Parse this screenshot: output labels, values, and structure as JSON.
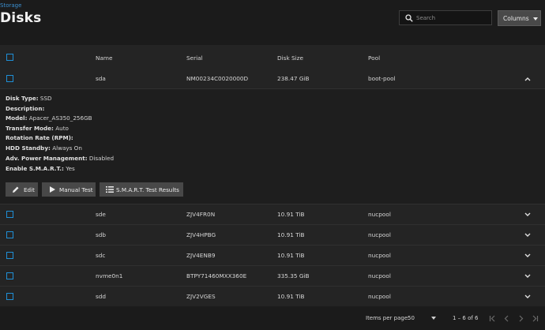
{
  "breadcrumb": "Storage",
  "page_title": "Disks",
  "search": {
    "placeholder": "Search"
  },
  "columns_button": {
    "label": "Columns"
  },
  "table": {
    "headers": [
      "Name",
      "Serial",
      "Disk Size",
      "Pool"
    ],
    "rows": [
      {
        "name": "sda",
        "serial": "NM00234C0020000D",
        "size": "238.47 GiB",
        "pool": "boot-pool",
        "expanded": true
      },
      {
        "name": "sde",
        "serial": "ZJV4FR0N",
        "size": "10.91 TiB",
        "pool": "nucpool",
        "expanded": false
      },
      {
        "name": "sdb",
        "serial": "ZJV4HPBG",
        "size": "10.91 TiB",
        "pool": "nucpool",
        "expanded": false
      },
      {
        "name": "sdc",
        "serial": "ZJV4ENB9",
        "size": "10.91 TiB",
        "pool": "nucpool",
        "expanded": false
      },
      {
        "name": "nvme0n1",
        "serial": "BTPY71460MXX360E",
        "size": "335.35 GiB",
        "pool": "nucpool",
        "expanded": false
      },
      {
        "name": "sdd",
        "serial": "ZJV2VGES",
        "size": "10.91 TiB",
        "pool": "nucpool",
        "expanded": false
      }
    ]
  },
  "details": [
    {
      "label": "Disk Type:",
      "value": "SSD"
    },
    {
      "label": "Description:",
      "value": ""
    },
    {
      "label": "Model:",
      "value": "Apacer_AS350_256GB"
    },
    {
      "label": "Transfer Mode:",
      "value": "Auto"
    },
    {
      "label": "Rotation Rate (RPM):",
      "value": ""
    },
    {
      "label": "HDD Standby:",
      "value": "Always On"
    },
    {
      "label": "Adv. Power Management:",
      "value": "Disabled"
    },
    {
      "label": "Enable S.M.A.R.T.:",
      "value": "Yes"
    }
  ],
  "actions": {
    "edit": "Edit",
    "manual_test": "Manual Test",
    "smart_results": "S.M.A.R.T. Test Results"
  },
  "paginator": {
    "items_per_page_label": "Items per page:",
    "items_per_page": "50",
    "range": "1 – 6 of 6"
  },
  "colors": {
    "accent": "#1f8fd6",
    "background": "#1b1b1b",
    "card": "#242424"
  }
}
